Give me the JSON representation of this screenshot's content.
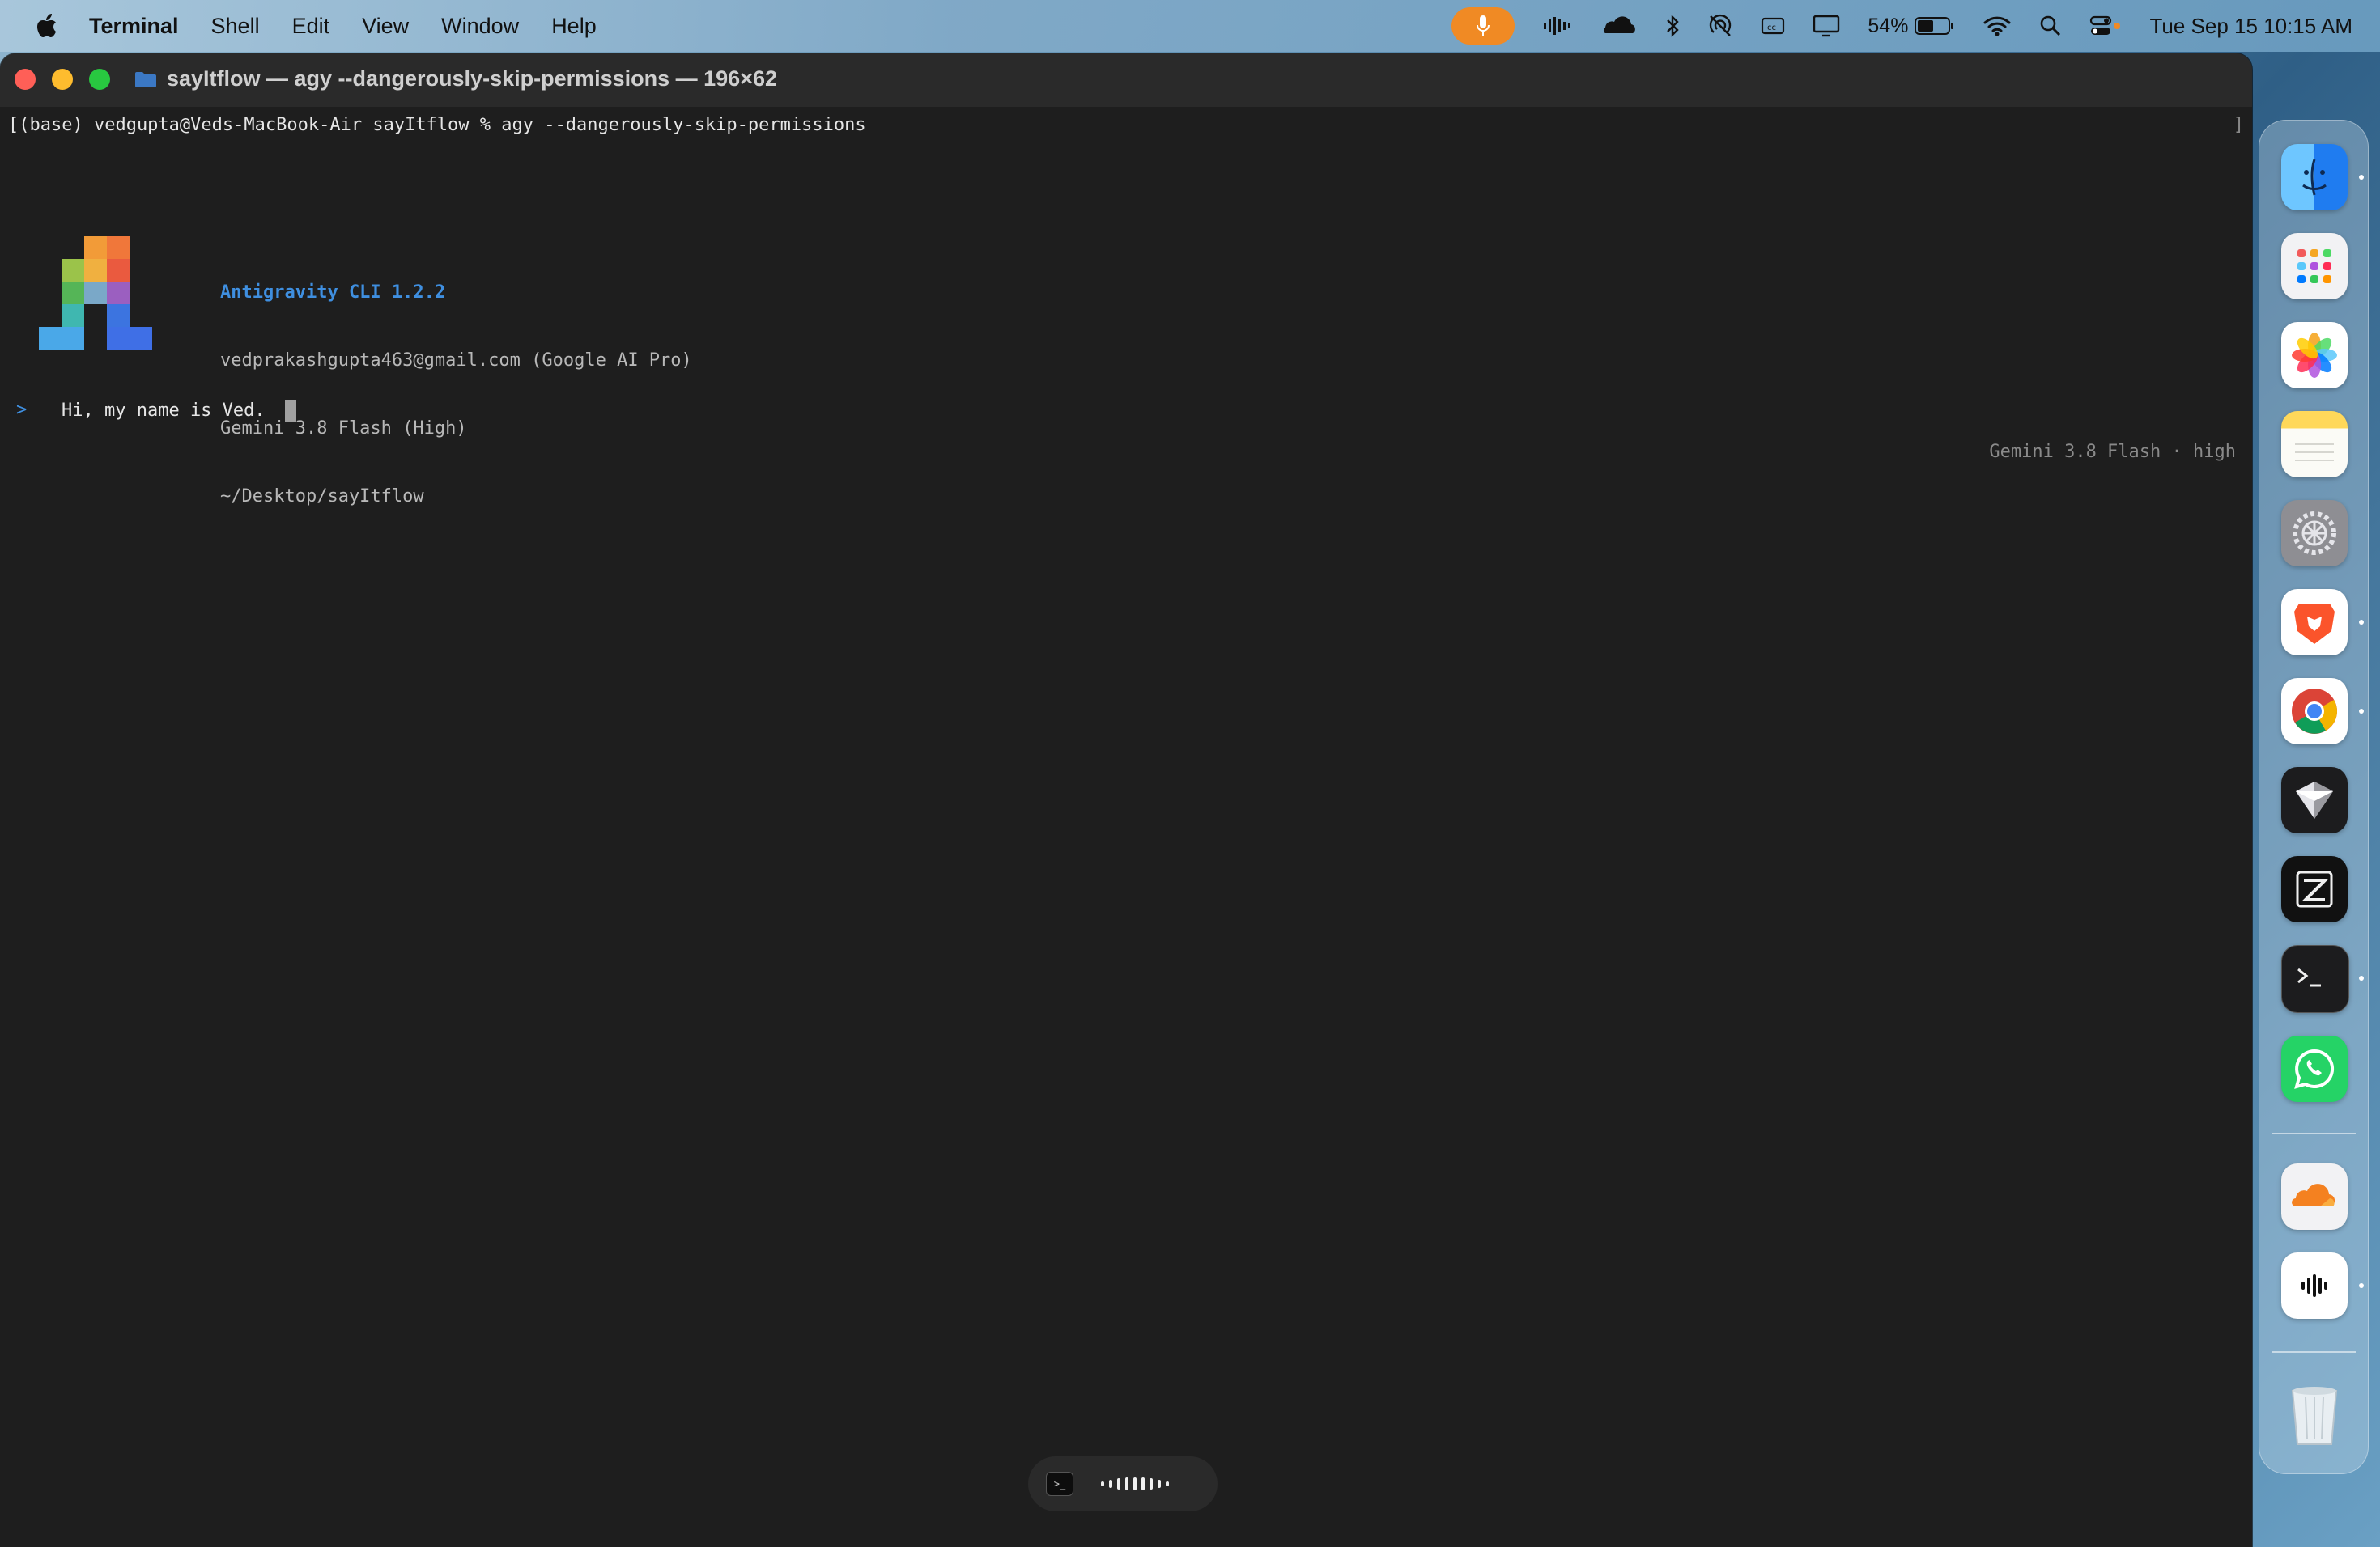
{
  "menubar": {
    "app_name": "Terminal",
    "items": [
      "Shell",
      "Edit",
      "View",
      "Window",
      "Help"
    ],
    "battery_percent": "54%",
    "battery_level": 0.54,
    "clock": "Tue Sep 15  10:15 AM"
  },
  "window": {
    "title": "sayItflow — agy --dangerously-skip-permissions — 196×62"
  },
  "terminal": {
    "command_line": "[(base) vedgupta@Veds-MacBook-Air sayItflow % agy --dangerously-skip-permissions",
    "right_bracket": "]",
    "cli_name": "Antigravity CLI 1.2.2",
    "account": "vedprakashgupta463@gmail.com (Google AI Pro)",
    "model": "Gemini 3.8 Flash (High)",
    "path": "~/Desktop/sayItflow",
    "prompt_symbol": ">",
    "prompt_text": "Hi, my name is Ved.",
    "model_status": "Gemini 3.8 Flash · high"
  },
  "float_pill": {
    "terminal_glyph": ">_"
  },
  "dock": {
    "apps": [
      "finder",
      "launchpad",
      "photos",
      "notes",
      "system-settings",
      "brave",
      "chrome",
      "perplexity",
      "zed",
      "terminal",
      "whatsapp",
      "cloudflare-warp",
      "voice-memos",
      "trash"
    ]
  },
  "colors": {
    "accent_blue": "#3f8fe0",
    "mic_orange": "#f08a24",
    "terminal_bg": "#1e1e1e"
  }
}
